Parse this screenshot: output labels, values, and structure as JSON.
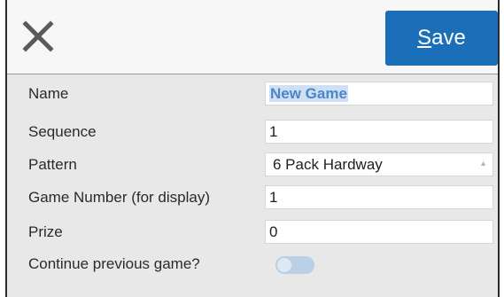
{
  "header": {
    "close_icon": "close-icon",
    "save_label_underlined": "S",
    "save_label_rest": "ave"
  },
  "form": {
    "name_label": "Name",
    "name_value": "New Game",
    "sequence_label": "Sequence",
    "sequence_value": "1",
    "pattern_label": "Pattern",
    "pattern_value": "6 Pack Hardway",
    "game_number_label": "Game Number (for display)",
    "game_number_value": "1",
    "prize_label": "Prize",
    "prize_value": "0",
    "continue_label": "Continue previous game?",
    "continue_value": false
  },
  "colors": {
    "accent": "#1a6fb8",
    "toggle_off": "#b9d0e6"
  }
}
